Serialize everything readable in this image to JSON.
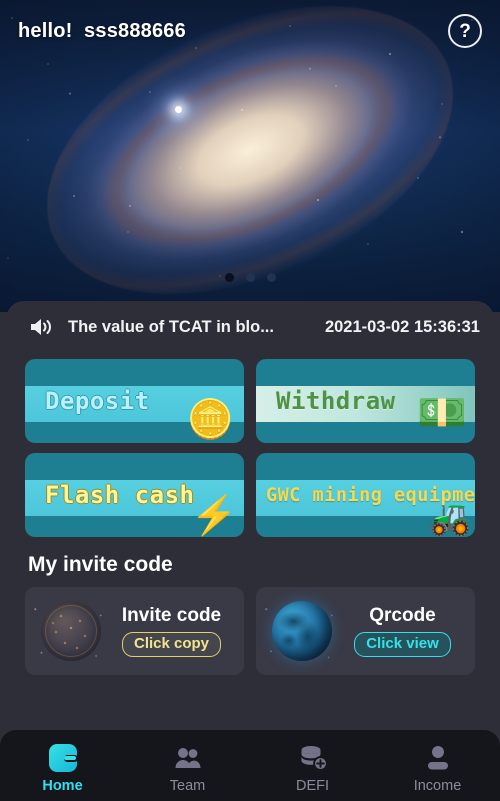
{
  "header": {
    "greeting": "hello!  sss888666",
    "help_icon_label": "?"
  },
  "banner": {
    "carousel_dots": 3,
    "active_dot_index": 0
  },
  "notice": {
    "icon": "speaker-icon",
    "text": "The value of TCAT in blo...",
    "timestamp": "2021-03-02 15:36:31"
  },
  "actions": [
    {
      "key": "deposit",
      "label": "Deposit",
      "art": "🪙"
    },
    {
      "key": "withdraw",
      "label": "Withdraw",
      "art": "💵"
    },
    {
      "key": "flash",
      "label": "Flash cash",
      "art": "⚡"
    },
    {
      "key": "gwc",
      "label": "GWC mining equipment",
      "art": "🚜"
    }
  ],
  "invite": {
    "section_title": "My invite code",
    "cards": [
      {
        "key": "invite-code",
        "label": "Invite code",
        "action": "Click copy",
        "icon": "network-sphere-icon"
      },
      {
        "key": "qrcode",
        "label": "Qrcode",
        "action": "Click view",
        "icon": "globe-icon"
      }
    ]
  },
  "tabbar": {
    "items": [
      {
        "key": "home",
        "label": "Home",
        "icon": "wallet-icon",
        "active": true
      },
      {
        "key": "team",
        "label": "Team",
        "icon": "people-icon",
        "active": false
      },
      {
        "key": "defi",
        "label": "DEFI",
        "icon": "coins-plus-icon",
        "active": false
      },
      {
        "key": "income",
        "label": "Income",
        "icon": "person-icon",
        "active": false
      }
    ]
  },
  "colors": {
    "panel_bg": "#2e2e38",
    "card_bg": "#3a3a46",
    "action_teal": "#1d7f91",
    "band_cyan": "#4ec6da",
    "accent_cyan": "#2fe0ef",
    "accent_gold": "#e3d06a",
    "tabbar_bg": "#15161c"
  }
}
